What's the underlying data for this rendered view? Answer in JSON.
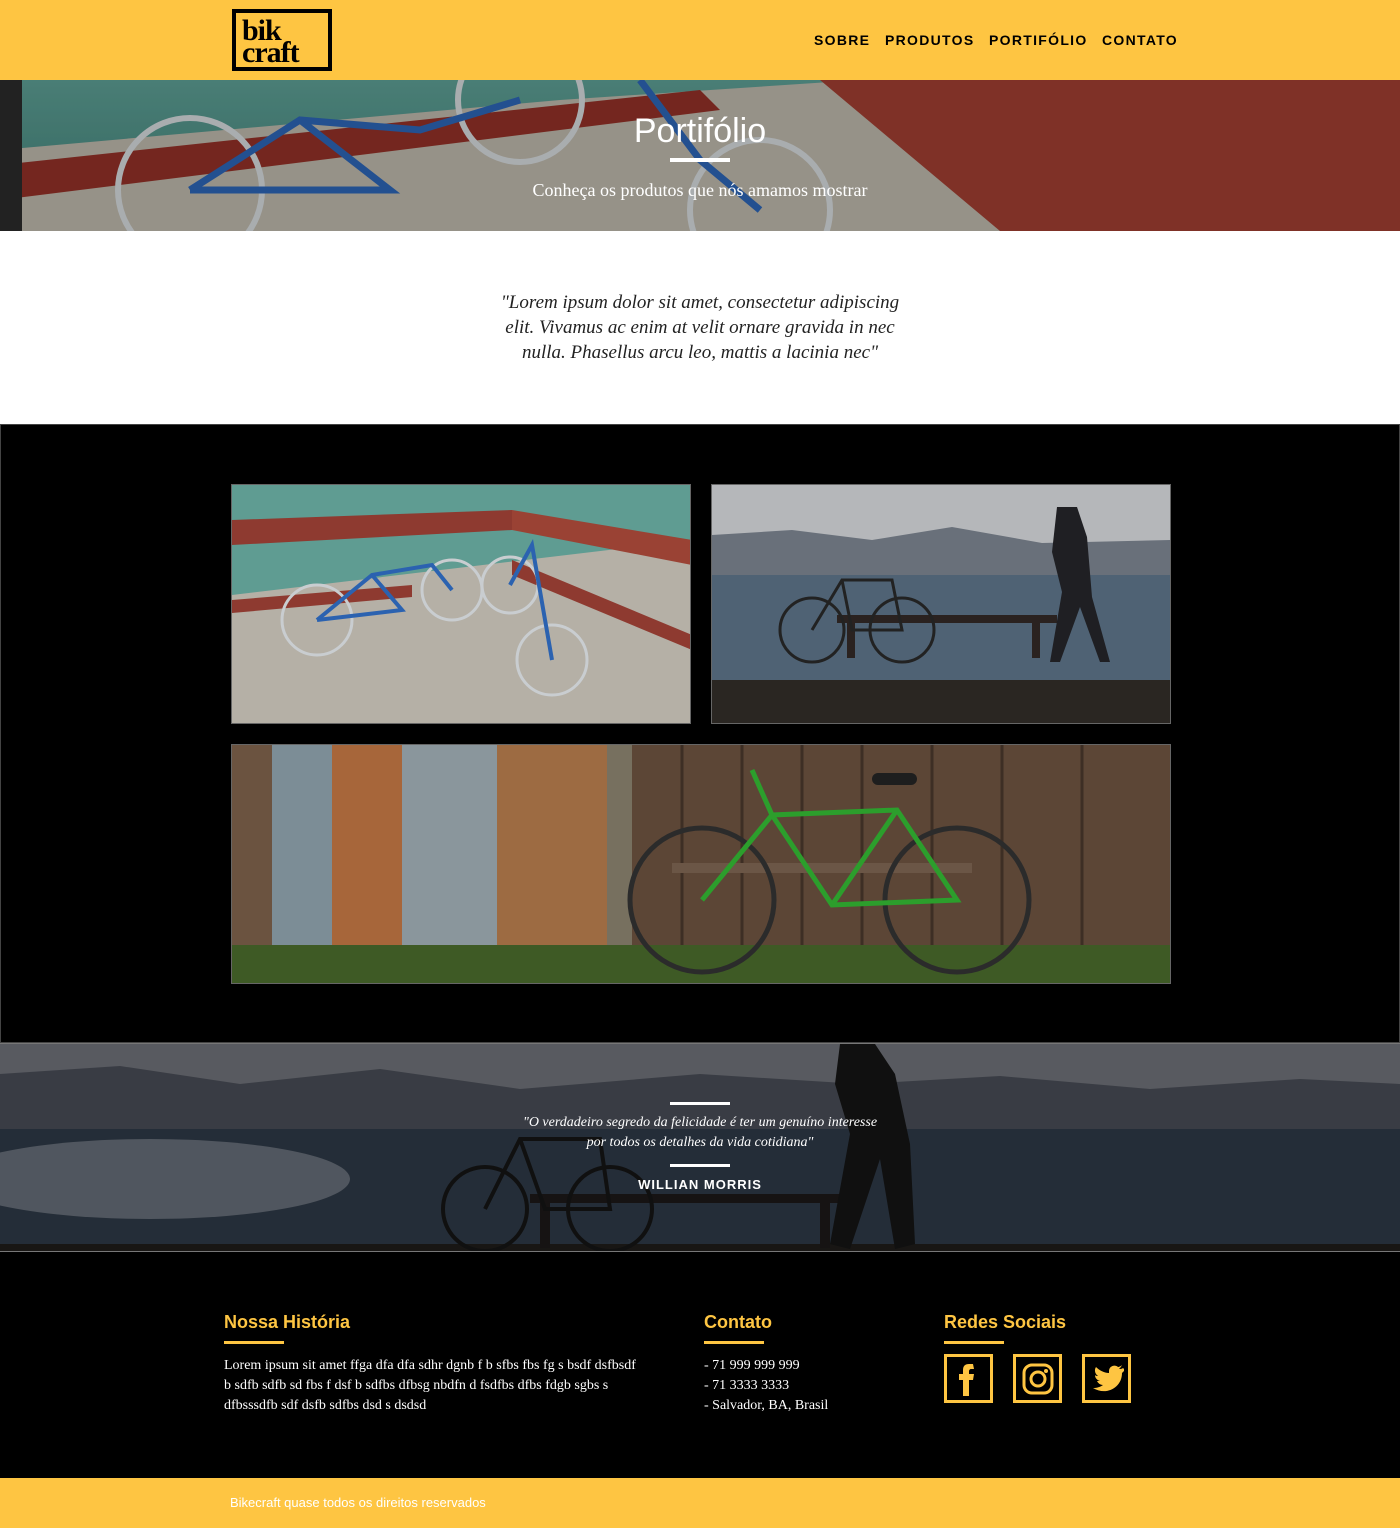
{
  "brand": {
    "logo_line1": "bik",
    "logo_line2": "craft"
  },
  "nav": {
    "items": [
      "SOBRE",
      "PRODUTOS",
      "PORTIFÓLIO",
      "CONTATO"
    ]
  },
  "hero": {
    "title": "Portifólio",
    "subtitle": "Conheça os produtos que nós amamos mostrar"
  },
  "intro": {
    "quote": "\"Lorem ipsum dolor sit amet, consectetur adipiscing elit. Vivamus ac enim at velit ornare gravida in nec nulla. Phasellus arcu leo, mattis a lacinia nec\""
  },
  "banner": {
    "quote": "\"O verdadeiro segredo da felicidade é ter um genuíno interesse por todos os detalhes da vida cotidiana\"",
    "author": "WILLIAN MORRIS"
  },
  "footer": {
    "history": {
      "title": "Nossa História",
      "text": "Lorem ipsum sit amet ffga dfa dfa sdhr dgnb f b sfbs fbs fg s bsdf dsfbsdf b sdfb sdfb sd fbs f dsf b sdfbs dfbsg nbdfn d fsdfbs dfbs fdgb sgbs s dfbsssdfb sdf dsfb sdfbs dsd s dsdsd"
    },
    "contact": {
      "title": "Contato",
      "items": [
        "- 71 999 999 999",
        "- 71 3333 3333",
        "- Salvador, BA, Brasil"
      ]
    },
    "social": {
      "title": "Redes Sociais",
      "icons": [
        "facebook-icon",
        "instagram-icon",
        "twitter-icon"
      ]
    }
  },
  "copyright": "Bikecraft quase todos os direitos reservados",
  "colors": {
    "accent": "#fec542",
    "background": "#000000",
    "text_light": "#ffffff"
  }
}
